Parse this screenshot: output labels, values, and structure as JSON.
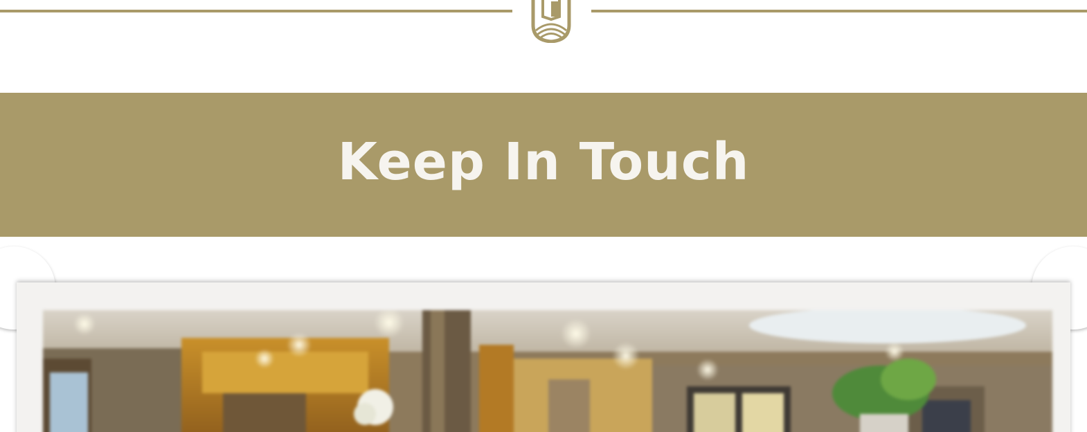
{
  "divider": {
    "emblem_icon": "shield-emblem-icon",
    "line_color": "#a99a69"
  },
  "banner": {
    "title": "Keep In Touch",
    "background_color": "#a99a69",
    "text_color": "#f6f4ef"
  },
  "photo": {
    "description_icon": "hotel-lobby-photo"
  }
}
